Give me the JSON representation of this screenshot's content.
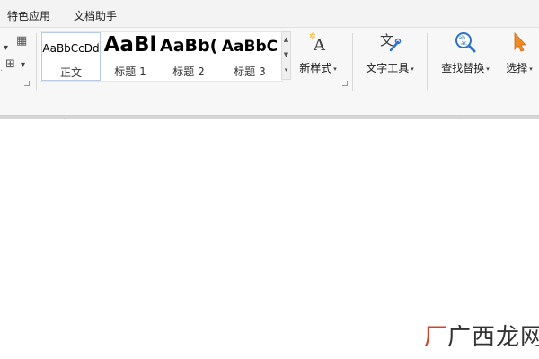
{
  "menu": {
    "items": [
      "特色应用",
      "文档助手"
    ]
  },
  "styles": {
    "items": [
      {
        "preview": "AaBbCcDd",
        "label": "正文"
      },
      {
        "preview": "AaBl",
        "label": "标题 1"
      },
      {
        "preview": "AaBb(",
        "label": "标题 2"
      },
      {
        "preview": "AaBbC",
        "label": "标题 3"
      }
    ]
  },
  "toolbar": {
    "new_style": "新样式",
    "text_tools": "文字工具",
    "find_replace": "查找替换",
    "select": "选择"
  },
  "watermark": {
    "text": "广西龙网",
    "logo": "厂"
  },
  "colors": {
    "accent_orange": "#f08a24",
    "icon_blue": "#2c72c6",
    "watermark_red": "#d8402a"
  }
}
